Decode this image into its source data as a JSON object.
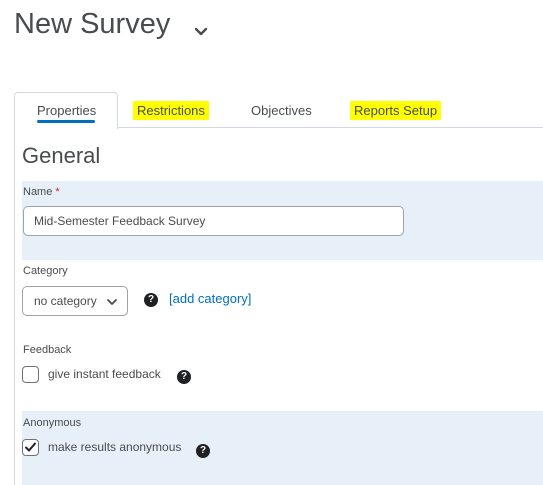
{
  "page": {
    "title": "New Survey"
  },
  "tabs": [
    {
      "label": "Properties",
      "active": true,
      "highlighted": false
    },
    {
      "label": "Restrictions",
      "active": false,
      "highlighted": true
    },
    {
      "label": "Objectives",
      "active": false,
      "highlighted": false
    },
    {
      "label": "Reports Setup",
      "active": false,
      "highlighted": true
    }
  ],
  "general": {
    "heading": "General",
    "name": {
      "label": "Name",
      "required_mark": "*",
      "value": "Mid-Semester Feedback Survey"
    },
    "category": {
      "label": "Category",
      "selected": "no category",
      "add_link": "[add category]"
    },
    "feedback": {
      "label": "Feedback",
      "option_label": "give instant feedback",
      "checked": false
    },
    "anonymous": {
      "label": "Anonymous",
      "option_label": "make results anonymous",
      "checked": true
    }
  },
  "colors": {
    "link": "#006fbf",
    "highlight": "#ffff00",
    "band": "#e7f0f8",
    "tab_indicator": "#006fbf"
  },
  "icons": {
    "title_dropdown": "chevron-down-icon",
    "select_dropdown": "chevron-down-icon",
    "help": "help-icon",
    "checked": "checkmark-icon"
  }
}
